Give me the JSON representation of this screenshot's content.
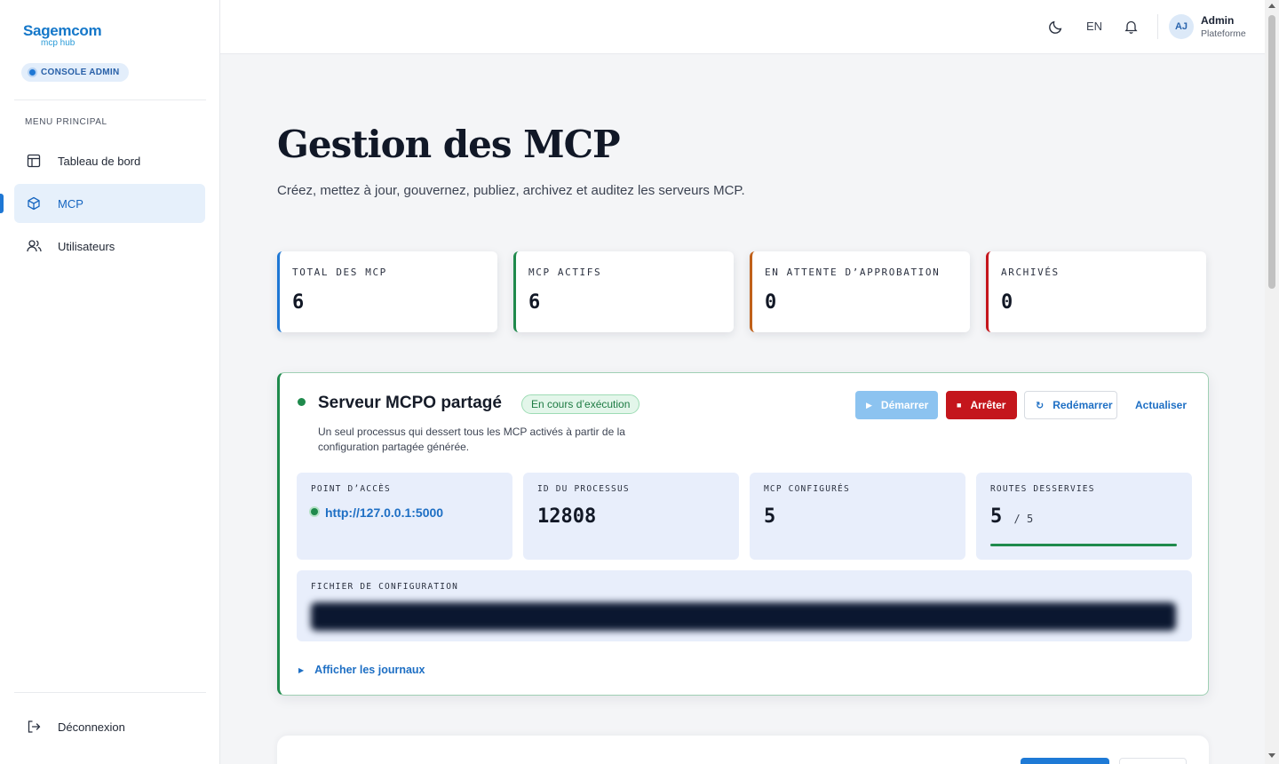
{
  "brand": {
    "name": "Sagemcom",
    "product": "mcp hub",
    "console_badge": "CONSOLE ADMIN"
  },
  "sidebar": {
    "menu_title": "MENU PRINCIPAL",
    "items": [
      {
        "label": "Tableau de bord",
        "icon": "layout-icon"
      },
      {
        "label": "MCP",
        "icon": "cube-icon",
        "active": true
      },
      {
        "label": "Utilisateurs",
        "icon": "users-icon"
      }
    ],
    "logout": "Déconnexion"
  },
  "topbar": {
    "language": "EN",
    "user_initials": "AJ",
    "user_name": "Admin",
    "user_role": "Plateforme"
  },
  "page": {
    "title": "Gestion des MCP",
    "subtitle": "Créez, mettez à jour, gouvernez, publiez, archivez et auditez les serveurs MCP."
  },
  "stats": [
    {
      "label": "TOTAL DES MCP",
      "value": "6",
      "color": "#1e77d4"
    },
    {
      "label": "MCP ACTIFS",
      "value": "6",
      "color": "#1f8a4c"
    },
    {
      "label": "EN ATTENTE D’APPROBATION",
      "value": "0",
      "color": "#c0611a"
    },
    {
      "label": "ARCHIVÉS",
      "value": "0",
      "color": "#c4161c"
    }
  ],
  "server": {
    "title": "Serveur MCPO partagé",
    "status": "En cours d’exécution",
    "description": "Un seul processus qui dessert tous les MCP activés à partir de la configuration partagée générée.",
    "buttons": {
      "start": "Démarrer",
      "stop": "Arrêter",
      "restart": "Redémarrer",
      "refresh": "Actualiser"
    },
    "endpoint": {
      "label": "POINT D’ACCÈS",
      "url": "http://127.0.0.1:5000"
    },
    "process": {
      "label": "ID DU PROCESSUS",
      "value": "12808"
    },
    "configured": {
      "label": "MCP CONFIGURÉS",
      "value": "5"
    },
    "routes": {
      "label": "ROUTES DESSERVIES",
      "served": "5",
      "total": "/ 5",
      "fraction": 1.0
    },
    "config_file": {
      "label": "FICHIER DE CONFIGURATION"
    },
    "logs_toggle": "Afficher les journaux"
  },
  "colors": {
    "accent": "#1e77d4",
    "success": "#1f8a4c",
    "danger": "#c4161c"
  }
}
